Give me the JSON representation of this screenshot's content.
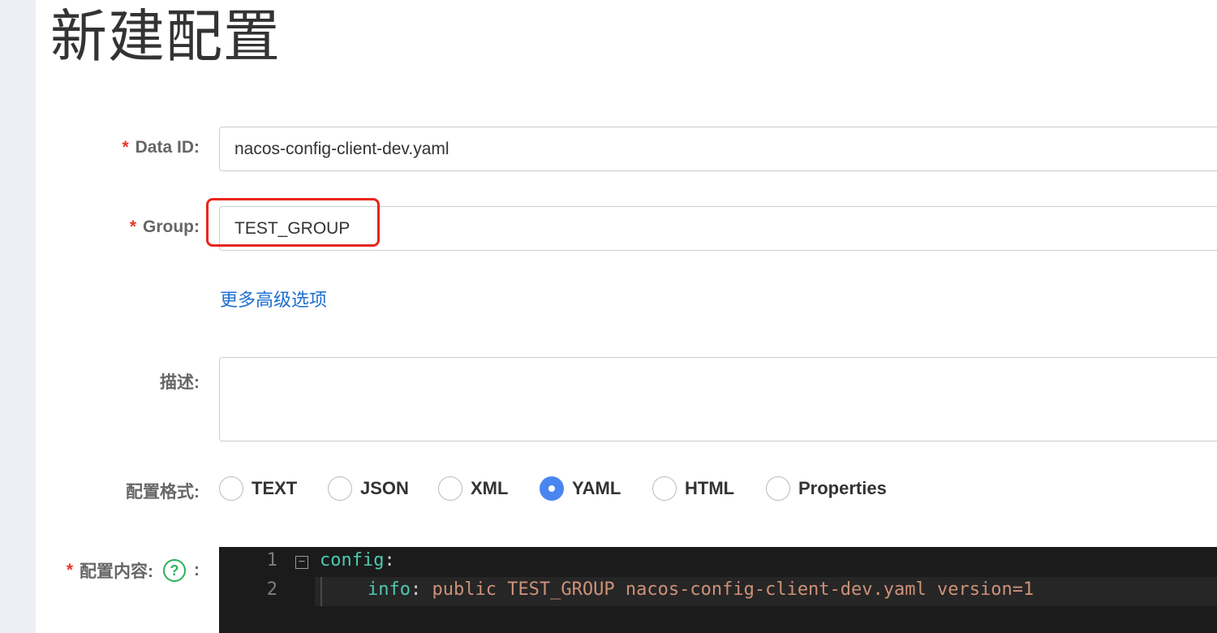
{
  "page": {
    "title": "新建配置"
  },
  "form": {
    "data_id": {
      "label": "Data ID:",
      "required_mark": "*",
      "value": "nacos-config-client-dev.yaml"
    },
    "group": {
      "label": "Group:",
      "required_mark": "*",
      "value": "TEST_GROUP"
    },
    "advanced_link": "更多高级选项",
    "description": {
      "label": "描述:",
      "value": ""
    },
    "format": {
      "label": "配置格式:",
      "selected": "YAML",
      "options": [
        "TEXT",
        "JSON",
        "XML",
        "YAML",
        "HTML",
        "Properties"
      ]
    },
    "content": {
      "label": "配置内容:",
      "required_mark": "*",
      "help_glyph": "?",
      "colon": ":"
    }
  },
  "editor": {
    "lines": [
      {
        "number": "1",
        "key": "config",
        "colon": ":",
        "value": ""
      },
      {
        "number": "2",
        "key": "info",
        "colon": ":",
        "value": " public TEST_GROUP nacos-config-client-dev.yaml version=1"
      }
    ],
    "fold_glyph": "−"
  },
  "colors": {
    "required": "#e8372c",
    "link": "#1f6fd1",
    "radio_checked": "#4a86f0",
    "highlight_box": "#e8261e",
    "help_icon": "#2db25a",
    "editor_bg": "#1b1b1b",
    "code_key": "#4ec9b0",
    "code_value": "#ce9178"
  },
  "icons": {
    "help": "question-circle-icon",
    "fold": "fold-minus-icon"
  }
}
